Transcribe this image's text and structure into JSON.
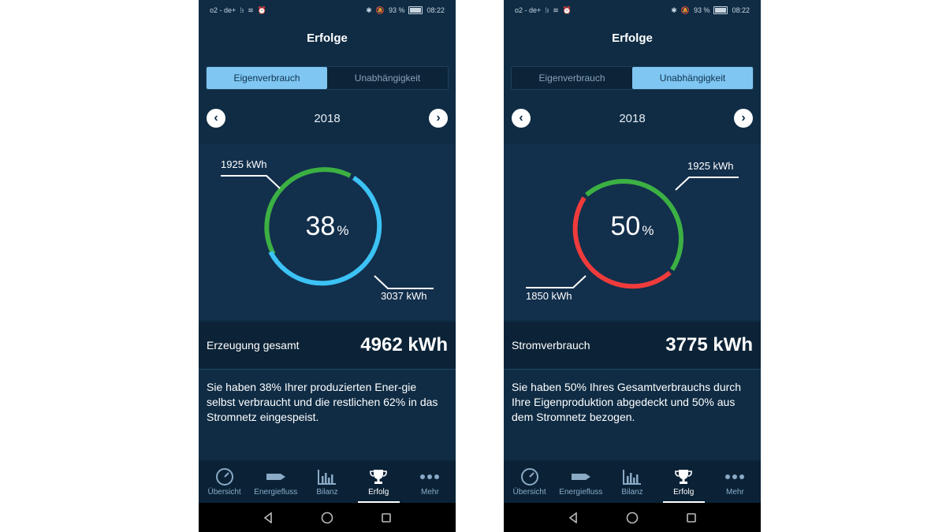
{
  "status_bar": {
    "carrier": "o2 - de+",
    "battery": "93 %",
    "time": "08:22"
  },
  "title": "Erfolge",
  "tabs": [
    "Eigenverbrauch",
    "Unabhängigkeit"
  ],
  "year": "2018",
  "nav": [
    "Übersicht",
    "Energiefluss",
    "Bilanz",
    "Erfolg",
    "Mehr"
  ],
  "colors": {
    "background": "#0f2c44",
    "panel": "#122f4c",
    "green": "#3cb043",
    "blue": "#3cc2f5",
    "red": "#ef3b3b",
    "tab_active": "#7fc6f2"
  },
  "screens": [
    {
      "active_tab": "Eigenverbrauch",
      "percent": "38",
      "percent_symbol": "%",
      "label_top": "1925 kWh",
      "label_bottom": "3037 kWh",
      "total_label": "Erzeugung gesamt",
      "total_value": "4962 kWh",
      "description": "Sie haben 38% Ihrer produzierten Ener-gie selbst verbraucht und die restlichen 62% in das Stromnetz eingespeist.",
      "chart_data": {
        "type": "donut",
        "center_value": 38,
        "segments": [
          {
            "label": "1925 kWh",
            "value": 1925,
            "color": "#3cb043"
          },
          {
            "label": "3037 kWh",
            "value": 3037,
            "color": "#3cc2f5"
          }
        ]
      }
    },
    {
      "active_tab": "Unabhängigkeit",
      "percent": "50",
      "percent_symbol": "%",
      "label_top": "1925 kWh",
      "label_bottom": "1850 kWh",
      "total_label": "Stromverbrauch",
      "total_value": "3775 kWh",
      "description": "Sie haben 50% Ihres Gesamtverbrauchs durch Ihre Eigenproduktion abgedeckt und 50% aus dem Stromnetz bezogen.",
      "chart_data": {
        "type": "donut",
        "center_value": 50,
        "segments": [
          {
            "label": "1925 kWh",
            "value": 1925,
            "color": "#3cb043"
          },
          {
            "label": "1850 kWh",
            "value": 1850,
            "color": "#ef3b3b"
          }
        ]
      }
    }
  ]
}
